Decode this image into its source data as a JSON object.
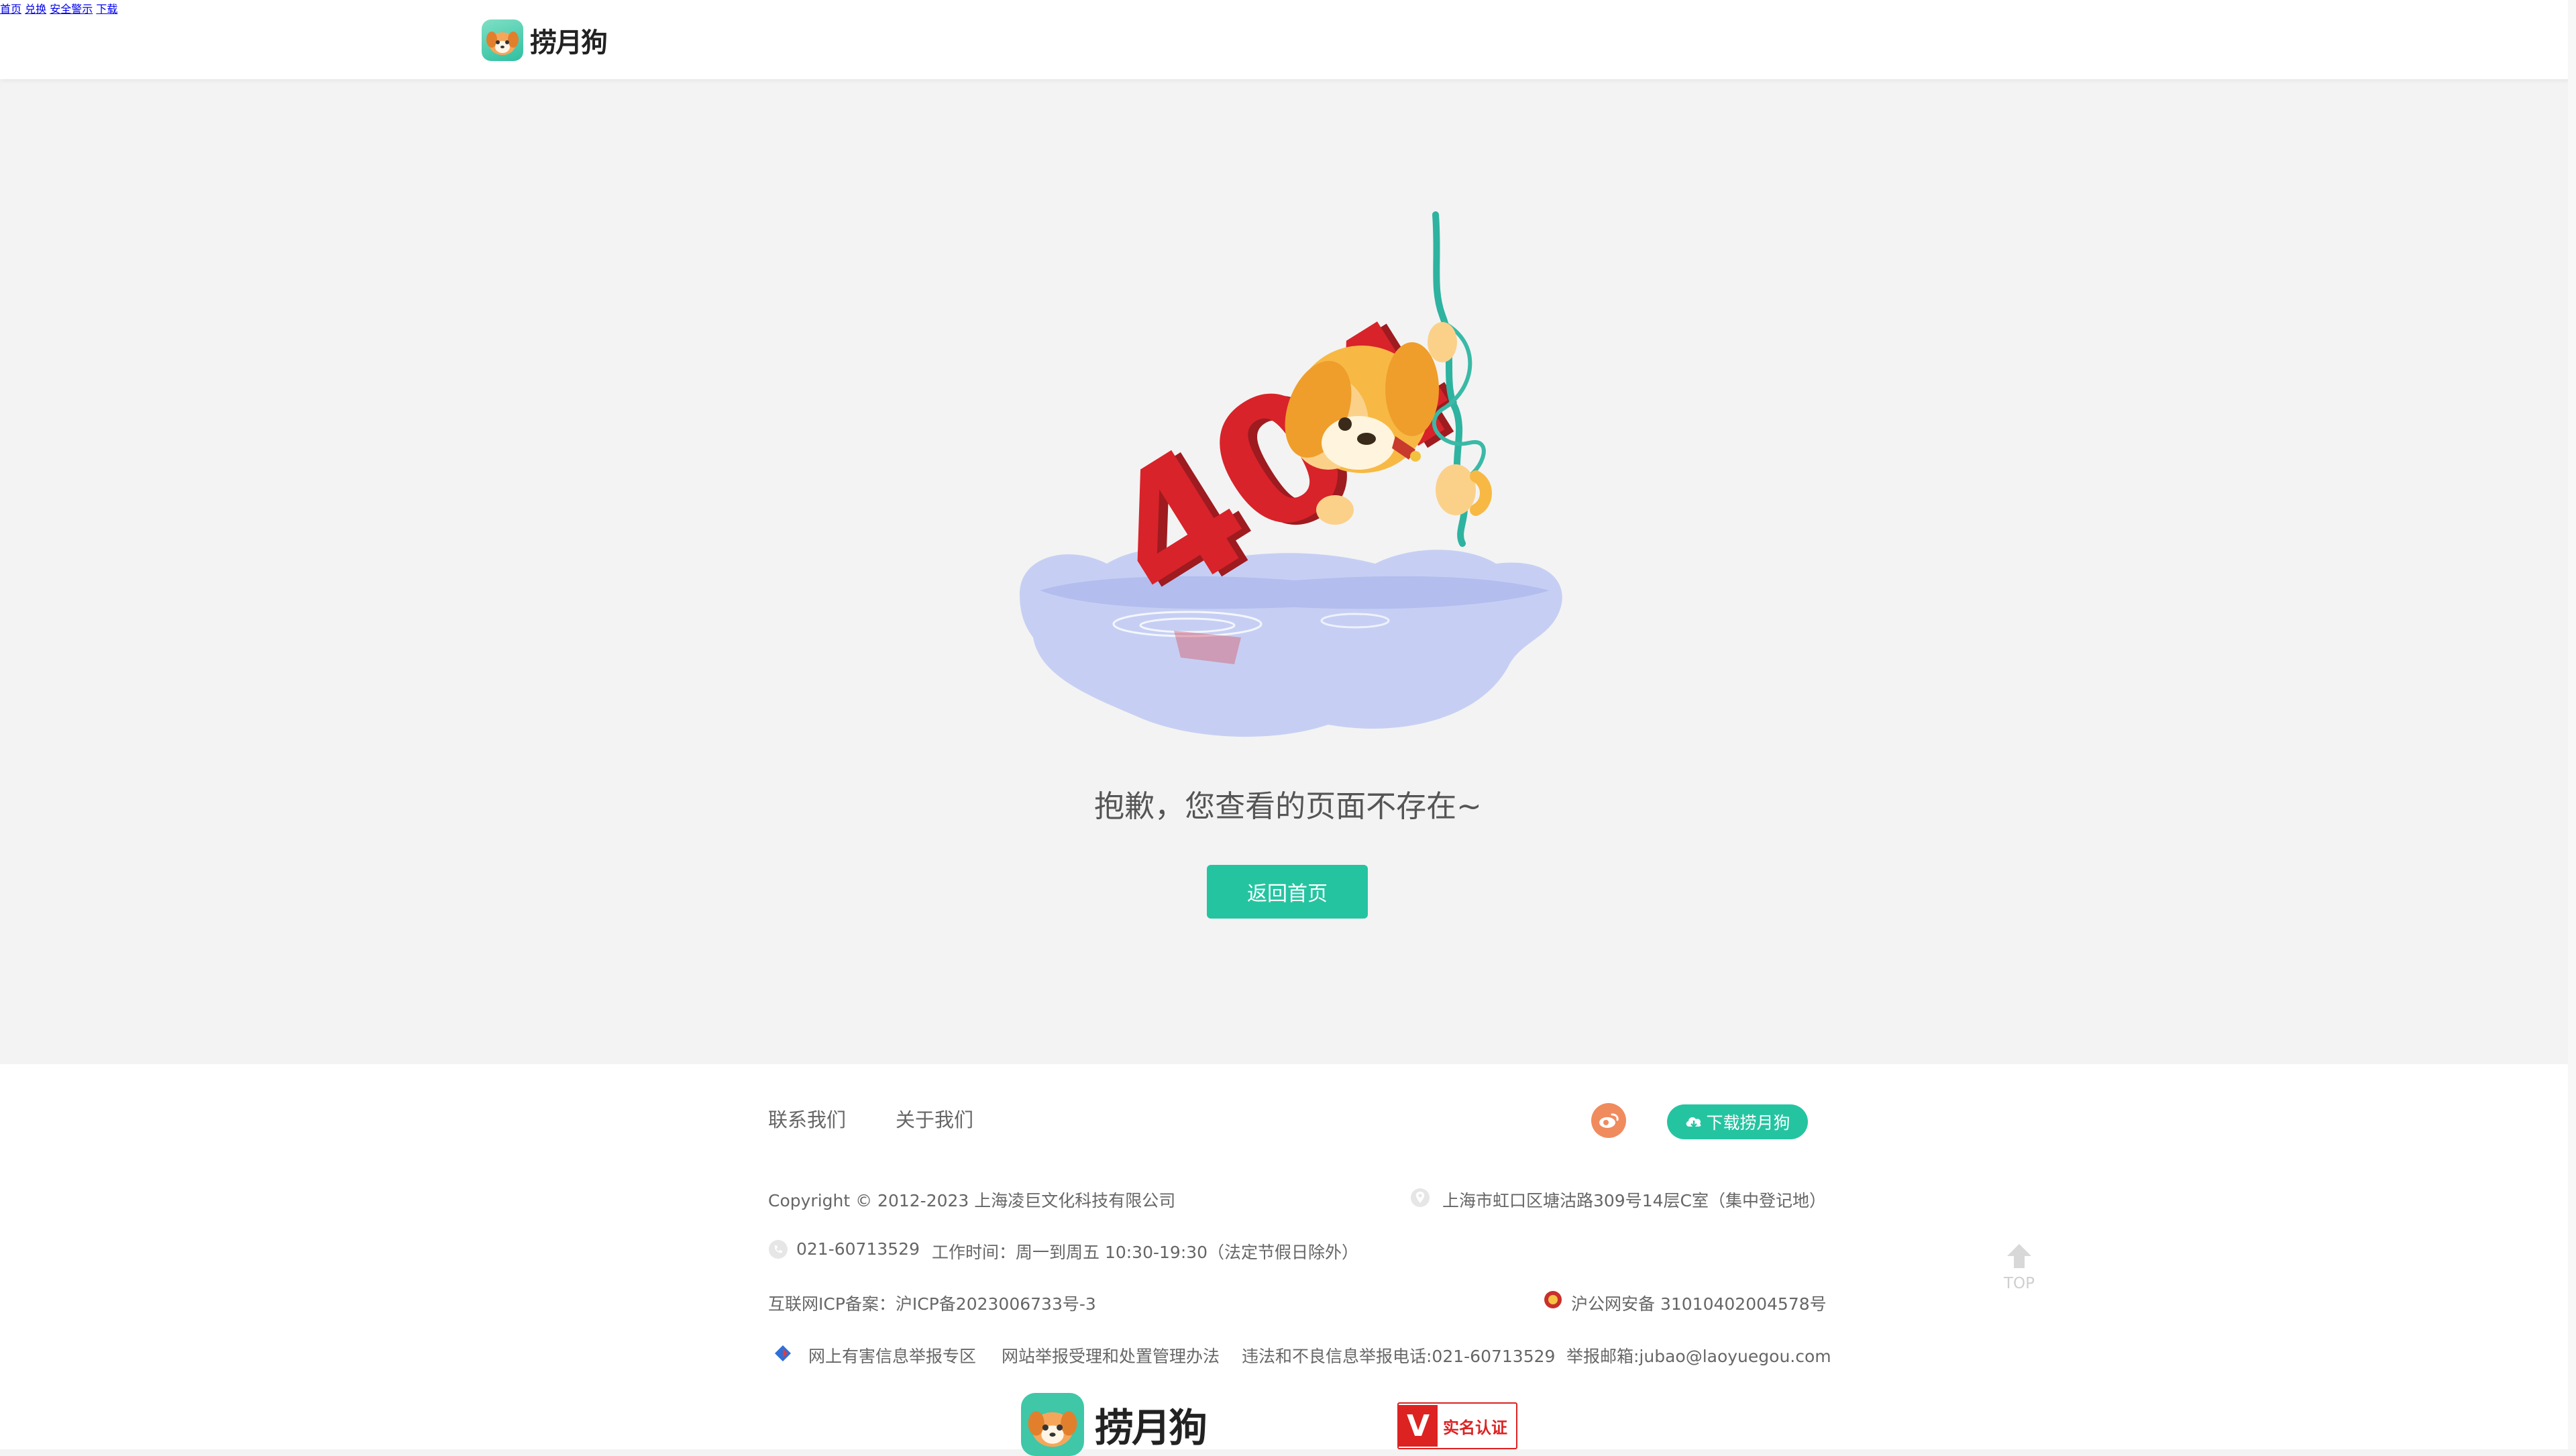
{
  "header": {
    "logo_text": "捞月狗",
    "nav": [
      {
        "label": "首页"
      },
      {
        "label": "兑换"
      },
      {
        "label": "安全警示"
      },
      {
        "label": "下载"
      }
    ]
  },
  "main": {
    "message": "抱歉，您查看的页面不存在~",
    "home_button": "返回首页",
    "illustration_text": "404"
  },
  "footer": {
    "links": [
      "联系我们",
      "关于我们"
    ],
    "download_button": "下载捞月狗",
    "copyright": "Copyright © 2012-2023 上海凌巨文化科技有限公司",
    "address": "上海市虹口区塘沽路309号14层C室（集中登记地）",
    "phone": "021-60713529",
    "work_hours": "工作时间：周一到周五 10:30-19:30（法定节假日除外）",
    "icp": "互联网ICP备案：沪ICP备2023006733号-3",
    "police": "沪公网安备 31010402004578号",
    "report_zone": "网上有害信息举报专区",
    "report_rules": "网站举报受理和处置管理办法",
    "report_phone": "违法和不良信息举报电话:021-60713529",
    "report_email": "举报邮箱:jubao@laoyuegou.com",
    "bottom_logo_text": "捞月狗",
    "cert_badge": "实名认证"
  },
  "top_button": "TOP",
  "colors": {
    "accent": "#25c4a1",
    "weibo": "#f08b5e",
    "error_red": "#d8232a"
  }
}
